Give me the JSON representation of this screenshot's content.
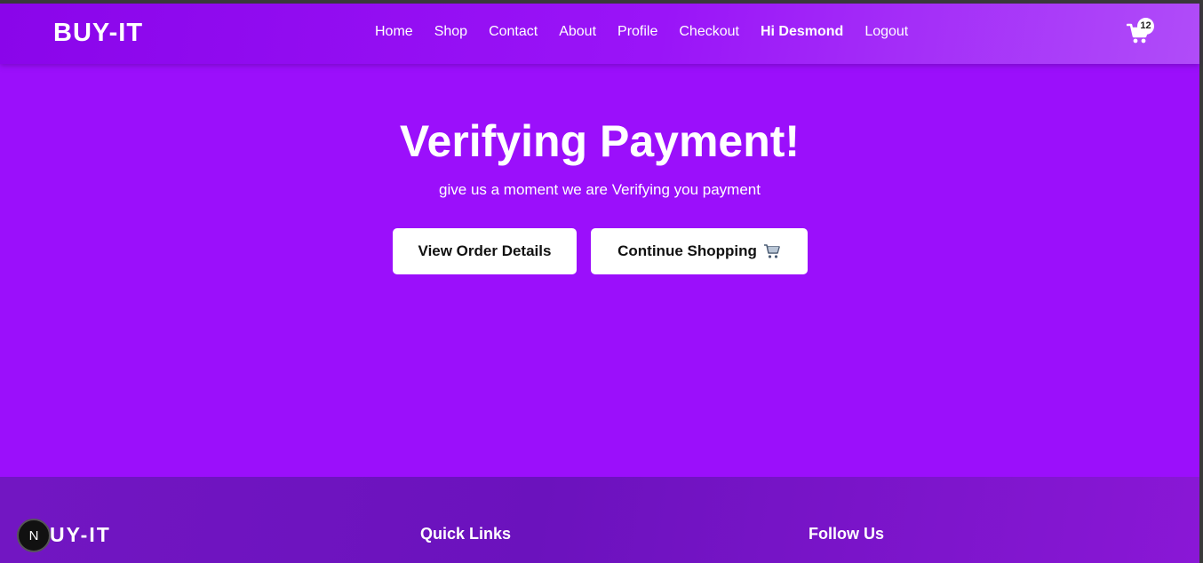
{
  "navbar": {
    "brand": "BUY-IT",
    "links": [
      "Home",
      "Shop",
      "Contact",
      "About",
      "Profile",
      "Checkout",
      "Hi Desmond",
      "Logout"
    ],
    "cart_count": "12",
    "cart_icon": "cart-icon"
  },
  "hero": {
    "title": "Verifying Payment!",
    "subtitle": "give us a moment we are Verifying you payment",
    "primary_button": "View Order Details",
    "secondary_button": "Continue Shopping",
    "secondary_button_icon": "shopping-cart-emoji"
  },
  "footer": {
    "brand": "UY-IT",
    "quick_links_heading": "Quick Links",
    "follow_heading": "Follow Us"
  },
  "dev_badge": {
    "label": "N"
  },
  "colors": {
    "background": "#9b0ffb",
    "navbar": "#8a05ea",
    "footer": "#7216c2",
    "button_bg": "#ffffff"
  }
}
